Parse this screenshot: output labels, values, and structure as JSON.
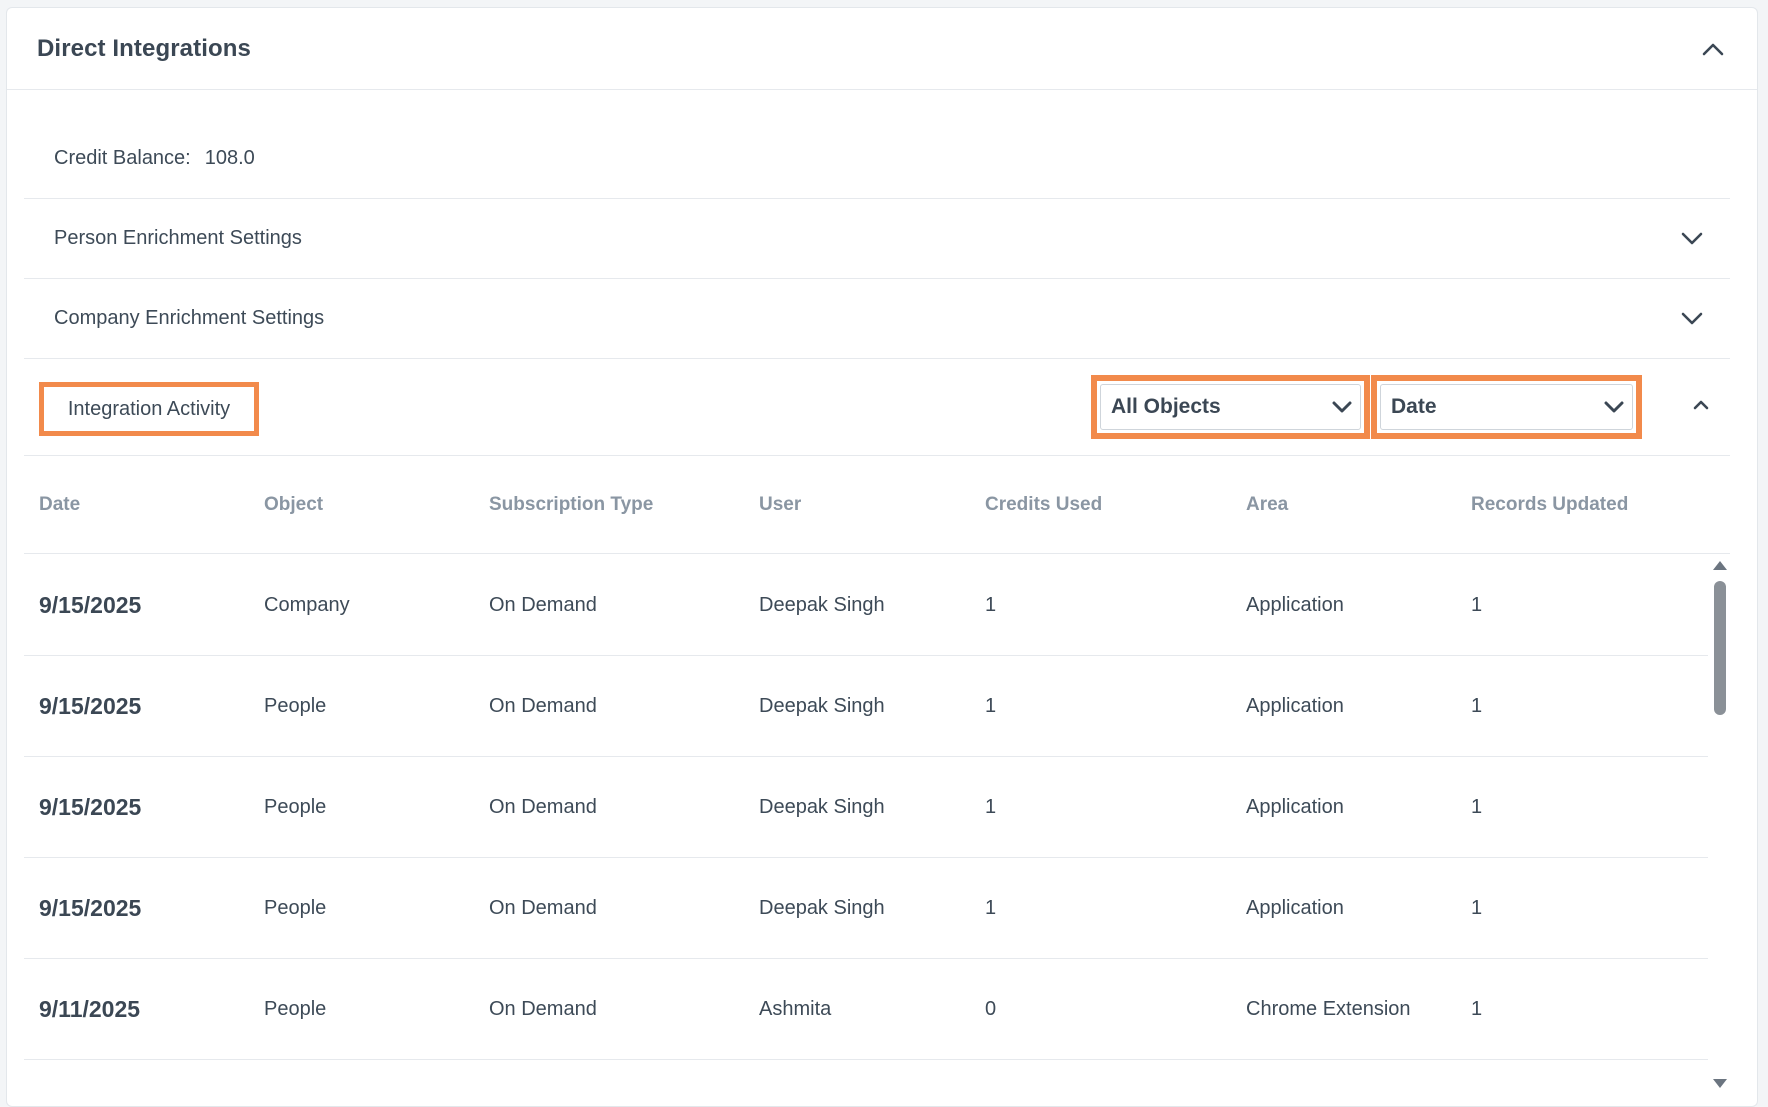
{
  "panel": {
    "title": "Direct Integrations"
  },
  "credit_balance": {
    "label": "Credit Balance:",
    "value": "108.0"
  },
  "sections": {
    "person": "Person Enrichment Settings",
    "company": "Company Enrichment Settings",
    "activity": "Integration Activity"
  },
  "filters": {
    "object": "All Objects",
    "sort": "Date"
  },
  "table": {
    "headers": {
      "date": "Date",
      "object": "Object",
      "subscription": "Subscription Type",
      "user": "User",
      "credits": "Credits Used",
      "area": "Area",
      "records": "Records Updated"
    },
    "rows": [
      {
        "date": "9/15/2025",
        "object": "Company",
        "subscription": "On Demand",
        "user": "Deepak Singh",
        "credits": "1",
        "area": "Application",
        "records": "1"
      },
      {
        "date": "9/15/2025",
        "object": "People",
        "subscription": "On Demand",
        "user": "Deepak Singh",
        "credits": "1",
        "area": "Application",
        "records": "1"
      },
      {
        "date": "9/15/2025",
        "object": "People",
        "subscription": "On Demand",
        "user": "Deepak Singh",
        "credits": "1",
        "area": "Application",
        "records": "1"
      },
      {
        "date": "9/15/2025",
        "object": "People",
        "subscription": "On Demand",
        "user": "Deepak Singh",
        "credits": "1",
        "area": "Application",
        "records": "1"
      },
      {
        "date": "9/11/2025",
        "object": "People",
        "subscription": "On Demand",
        "user": "Ashmita",
        "credits": "0",
        "area": "Chrome Extension",
        "records": "1"
      }
    ]
  },
  "colors": {
    "highlight": "#f28a4b",
    "text": "#3d4a57",
    "header_text": "#8a96a3",
    "divider": "#e6e9ed"
  },
  "icons": {
    "panel_toggle": "chevron-up-icon",
    "section_toggle": "chevron-down-icon",
    "select_arrow": "chevron-down-icon",
    "activity_toggle": "chevron-up-icon"
  }
}
